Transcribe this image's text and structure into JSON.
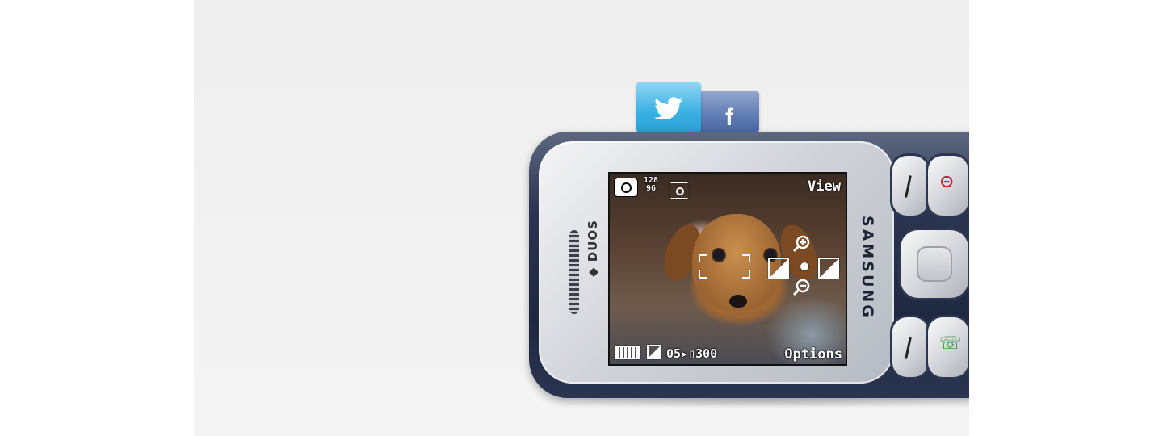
{
  "app_tiles": [
    {
      "name": "twitter",
      "icon": "twitter-bird-icon",
      "color": "#3bb0e3"
    },
    {
      "name": "facebook",
      "label": "f",
      "icon": "facebook-icon",
      "color": "#5f7cb5"
    }
  ],
  "phone": {
    "brand": "SAMSUNG",
    "model_label": "DUOS",
    "body_color": "#2b3551",
    "screen": {
      "top_right_label": "View",
      "bottom_right_label": "Options",
      "resolution_top": "128",
      "resolution_bottom": "96",
      "counter": "05",
      "remaining": "300",
      "icons": [
        "camera-icon",
        "metering-icon",
        "battery-icon",
        "exposure-icon",
        "storage-icon",
        "zoom-in-icon",
        "zoom-out-icon",
        "exposure-down-icon",
        "exposure-up-icon",
        "focus-frame-icon"
      ]
    },
    "keys": {
      "end_color": "#c0262a",
      "call_color": "#2e8b3a"
    }
  }
}
